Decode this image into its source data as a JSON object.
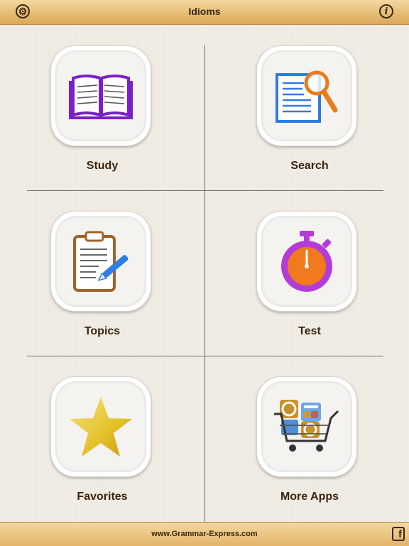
{
  "header": {
    "title": "Idioms",
    "settings_icon": "gear-icon",
    "info_icon": "info-icon",
    "info_glyph": "i"
  },
  "menu": {
    "study": "Study",
    "search": "Search",
    "topics": "Topics",
    "test": "Test",
    "favorites": "Favorites",
    "more_apps": "More Apps"
  },
  "footer": {
    "site": "www.Grammar-Express.com",
    "facebook_glyph": "f"
  },
  "colors": {
    "bar": "#e6bd74",
    "book": "#7a1fc9",
    "search_doc": "#2f7de1",
    "magnifier": "#ea7a1d",
    "clipboard": "#a0622a",
    "stopwatch": "#b33bd8",
    "star": "#e3c12a"
  }
}
